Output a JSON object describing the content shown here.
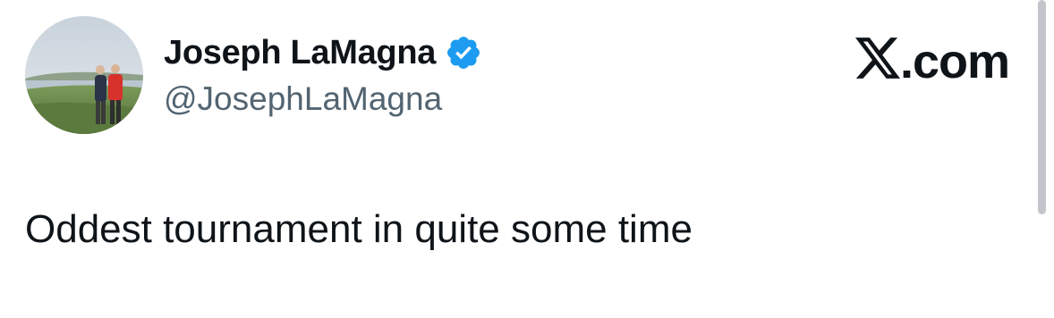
{
  "author": {
    "display_name": "Joseph LaMagna",
    "handle": "@JosephLaMagna",
    "verified": true,
    "verified_color": "#1d9bf0"
  },
  "brand": {
    "label": ".com",
    "icon": "x-logo-icon"
  },
  "tweet": {
    "text": "Oddest tournament in quite some time"
  },
  "colors": {
    "text_primary": "#0f1419",
    "text_secondary": "#536471",
    "background": "#ffffff"
  }
}
